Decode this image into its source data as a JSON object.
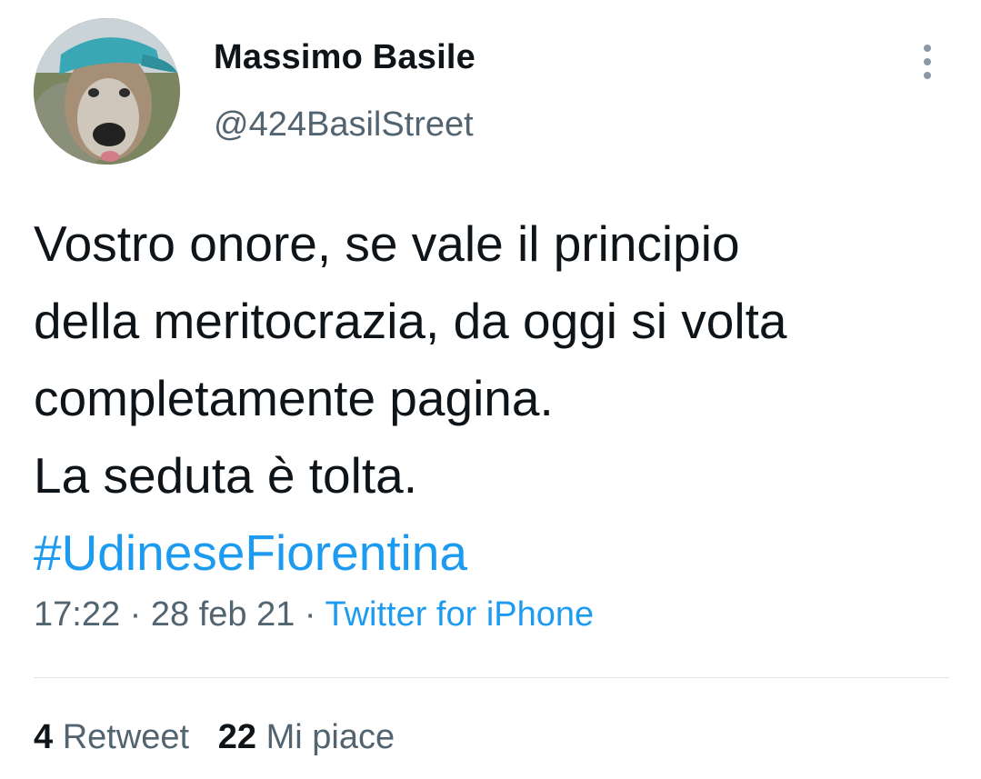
{
  "author": {
    "display_name": "Massimo Basile",
    "handle": "@424BasilStreet",
    "avatar_icon": "dog-with-cap-avatar"
  },
  "menu": {
    "icon": "more-vertical-icon"
  },
  "tweet": {
    "lines": [
      "Vostro onore, se vale il principio",
      "della meritocrazia, da oggi si volta",
      "completamente pagina.",
      "La seduta è tolta."
    ],
    "hashtag": "#UdineseFiorentina"
  },
  "meta": {
    "time": "17:22",
    "separator": " · ",
    "date": "28 feb 21",
    "source": "Twitter for iPhone"
  },
  "stats": {
    "retweets_count": "4",
    "retweets_label": "Retweet",
    "likes_count": "22",
    "likes_label": "Mi piace"
  },
  "colors": {
    "text": "#0f1419",
    "secondary": "#536471",
    "link": "#1d9bf0",
    "divider": "#dfe3e6"
  }
}
